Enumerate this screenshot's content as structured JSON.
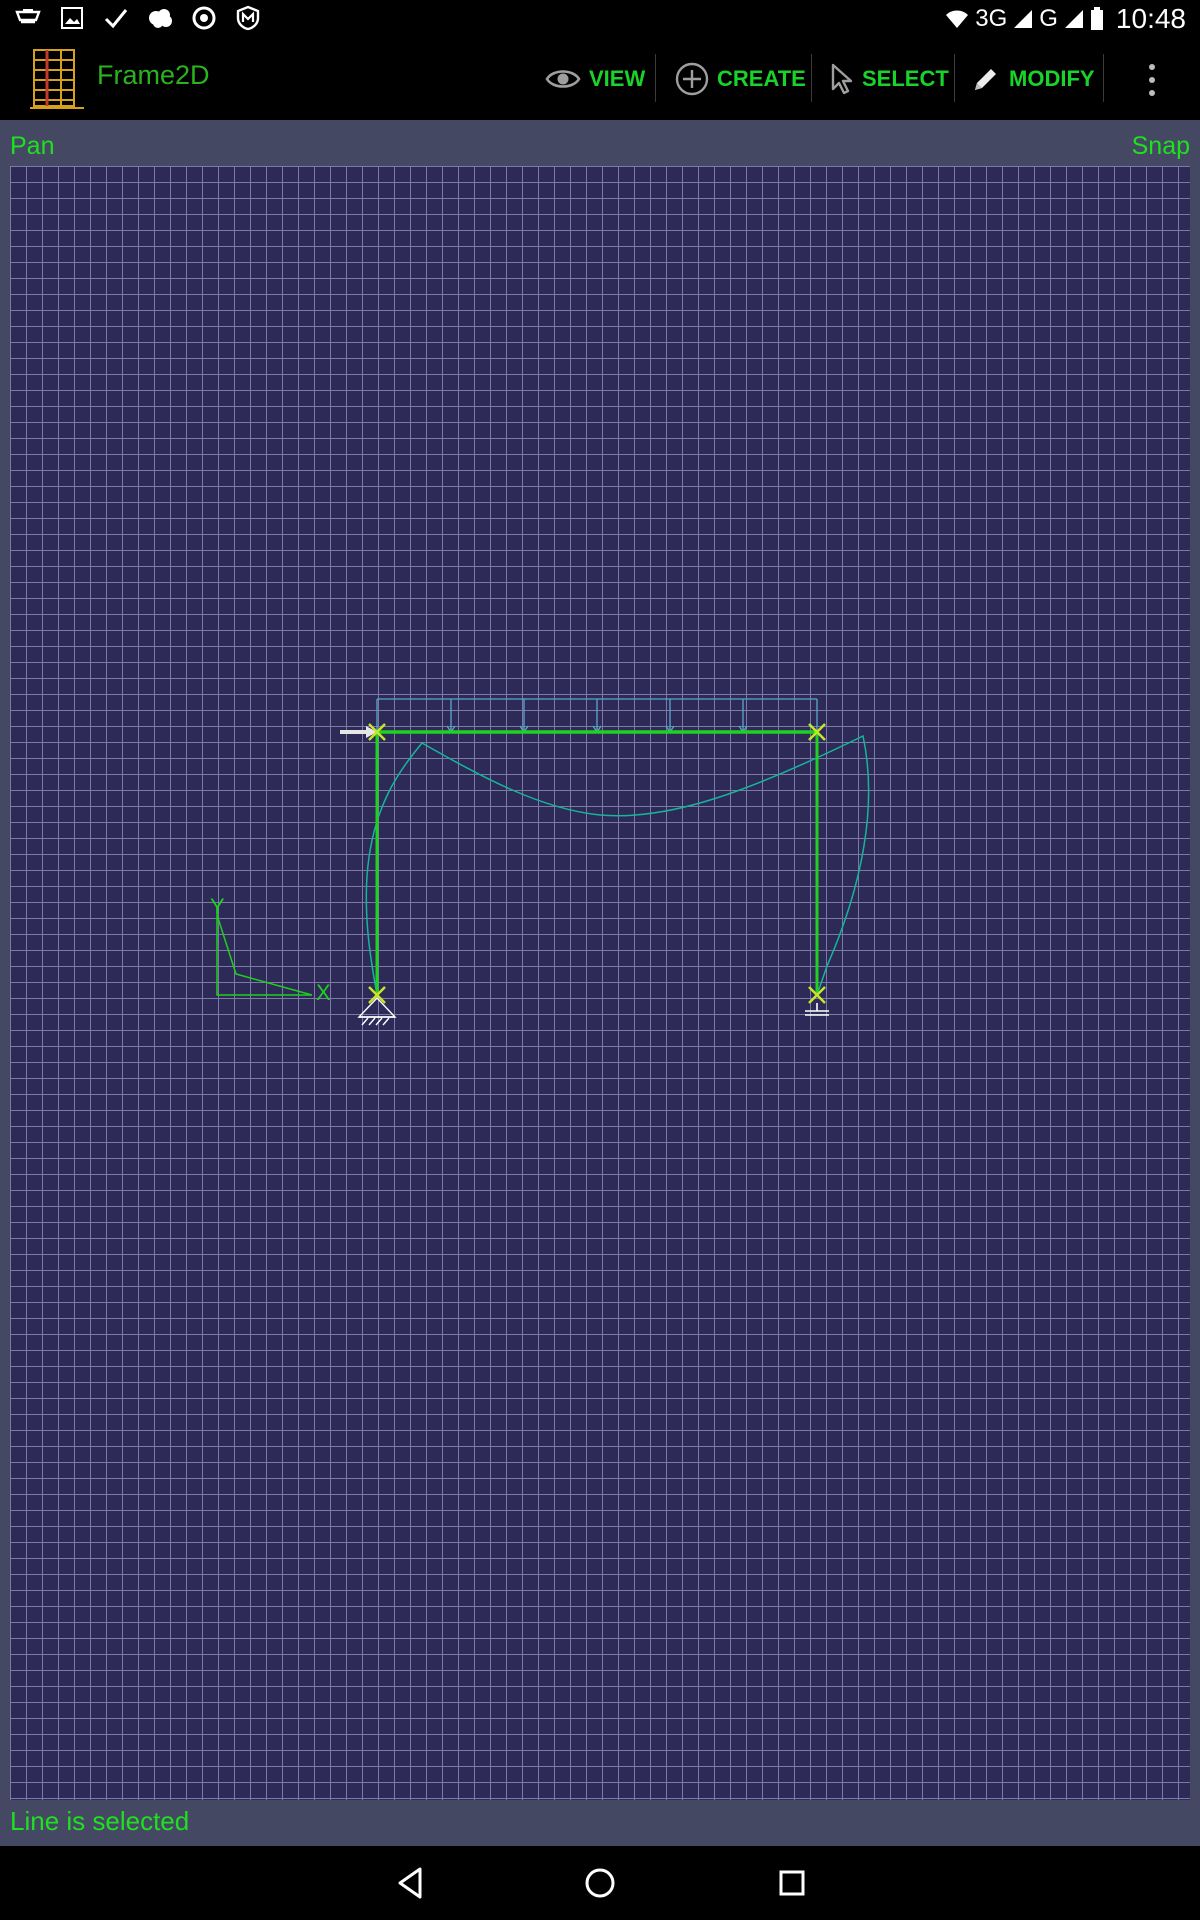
{
  "status_bar": {
    "network_label": "3G",
    "network2_label": "G",
    "time": "10:48"
  },
  "app": {
    "title": "Frame2D"
  },
  "toolbar": {
    "view_label": "VIEW",
    "create_label": "CREATE",
    "select_label": "SELECT",
    "modify_label": "MODIFY"
  },
  "mode_bar": {
    "mode": "Pan",
    "snap": "Snap"
  },
  "canvas": {
    "axis_x_label": "X",
    "axis_y_label": "Y"
  },
  "colors": {
    "accent": "#19d32a",
    "canvas_bg": "#2d2a57",
    "grid_line": "#7b79a6",
    "member": "#1fd21f",
    "deflection": "#16b59a",
    "load": "#5aa7c8",
    "node_marker": "#c6e52a"
  },
  "message": {
    "text": "Line is selected"
  }
}
